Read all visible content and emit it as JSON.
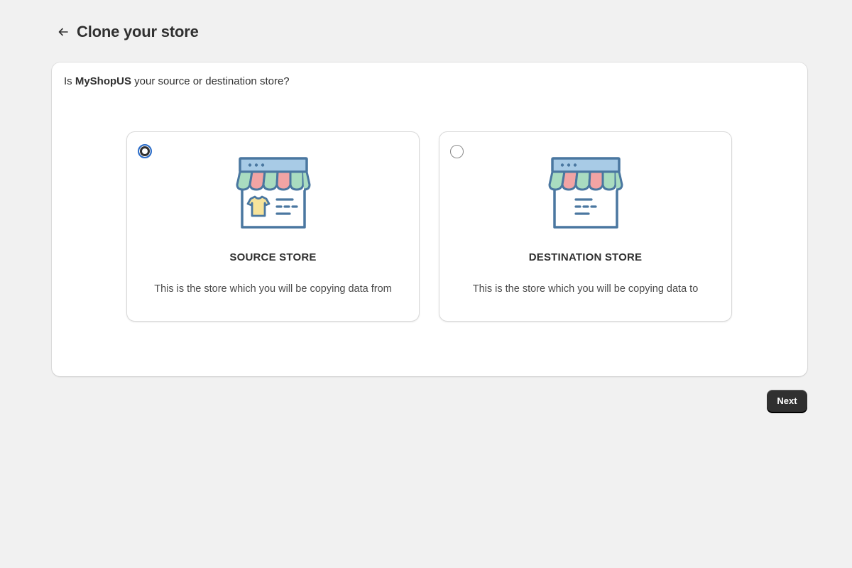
{
  "header": {
    "back_icon": "arrow-left-icon",
    "title": "Clone your store"
  },
  "question": {
    "prefix": "Is ",
    "store_name": "MyShopUS",
    "suffix": " your source or destination store?"
  },
  "options": [
    {
      "id": "source",
      "title": "SOURCE STORE",
      "description": "This is the store which you will be copying data from",
      "selected": true,
      "icon": "storefront-with-shirt-icon"
    },
    {
      "id": "destination",
      "title": "DESTINATION STORE",
      "description": "This is the store which you will be copying data to",
      "selected": false,
      "icon": "storefront-icon"
    }
  ],
  "footer": {
    "next_label": "Next"
  },
  "colors": {
    "background": "#f1f1f1",
    "card": "#ffffff",
    "primary_button": "#303030",
    "radio_focus": "#2c6ecb",
    "icon_stroke": "#4a77a0",
    "awning_blue": "#a8cbe6",
    "awning_green": "#a9dcc0",
    "awning_pink": "#f2a4a4",
    "shirt_yellow": "#f7e39a"
  }
}
